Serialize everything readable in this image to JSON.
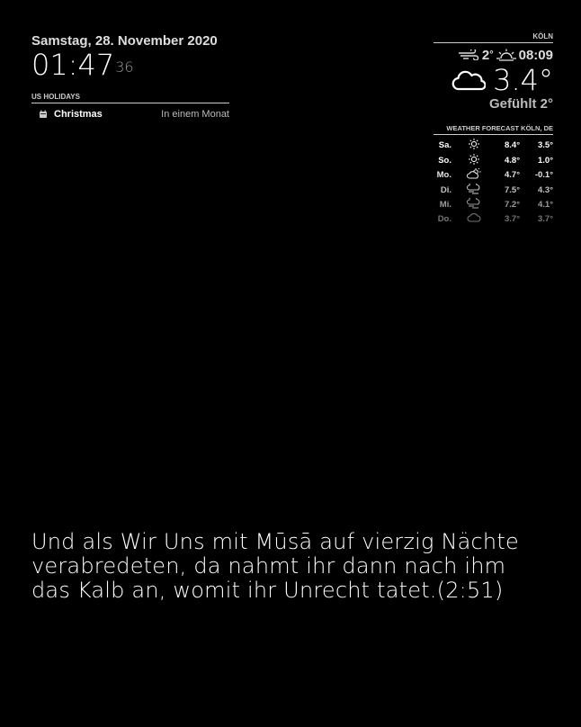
{
  "clock": {
    "date": "Samstag, 28. November 2020",
    "time": "01:47",
    "seconds": "36"
  },
  "calendar": {
    "header": "US HOLIDAYS",
    "events": [
      {
        "icon": "calendar-icon",
        "title": "Christmas",
        "time": "In einem Monat"
      }
    ]
  },
  "weather": {
    "location": "KÖLN",
    "wind_speed": "2",
    "wind_unit": "°",
    "sunrise": "08:09",
    "temperature": "3.4°",
    "feels_like": "Gefühlt 2°",
    "icon": "cloudy-icon"
  },
  "forecast": {
    "header": "WEATHER FORECAST KÖLN, DE",
    "days": [
      {
        "day": "Sa.",
        "icon": "sunny-icon",
        "max": "8.4°",
        "min": "3.5°",
        "opacity": 1.0
      },
      {
        "day": "So.",
        "icon": "sunny-icon",
        "max": "4.8°",
        "min": "1.0°",
        "opacity": 1.0
      },
      {
        "day": "Mo.",
        "icon": "partly-cloudy-icon",
        "max": "4.7°",
        "min": "-0.1°",
        "opacity": 0.9
      },
      {
        "day": "Di.",
        "icon": "rain-icon",
        "max": "7.5°",
        "min": "4.3°",
        "opacity": 0.75
      },
      {
        "day": "Mi.",
        "icon": "rain-icon",
        "max": "7.2°",
        "min": "4.1°",
        "opacity": 0.6
      },
      {
        "day": "Do.",
        "icon": "cloudy-icon",
        "max": "3.7°",
        "min": "3.7°",
        "opacity": 0.45
      }
    ]
  },
  "compliment": {
    "text": "Und als Wir Uns mit Mūsā auf vierzig Nächte verabredeten, da nahmt ihr dann nach ihm das Kalb an, womit ihr Unrecht tatet.(2:51)"
  }
}
